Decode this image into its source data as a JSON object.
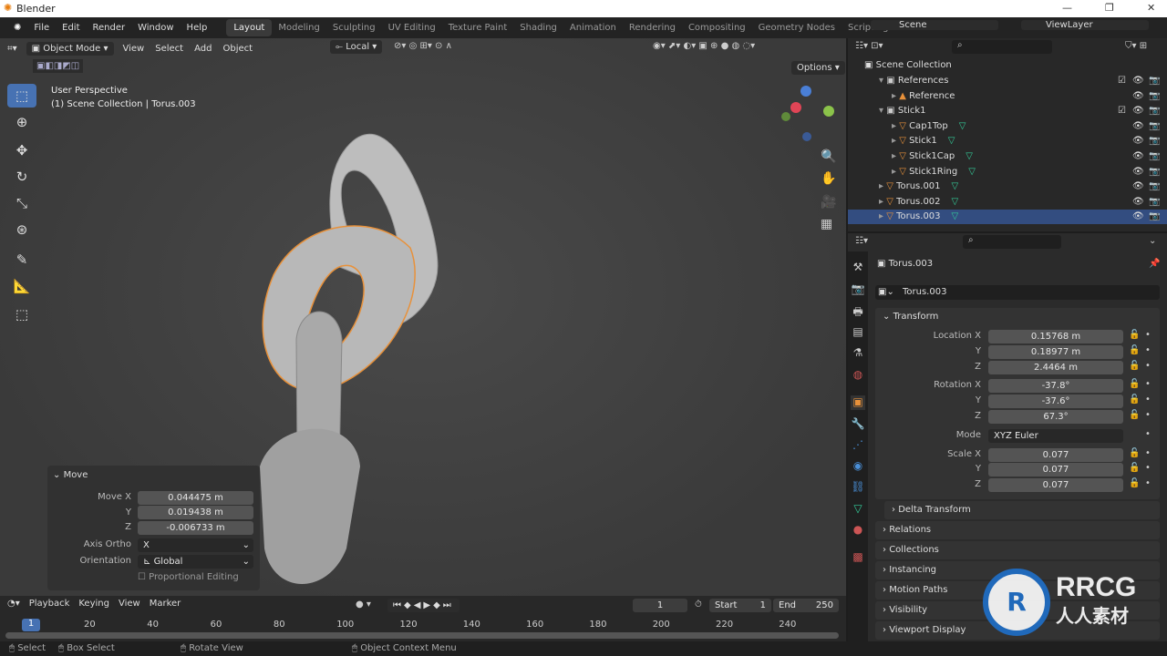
{
  "title": "Blender",
  "menu": [
    "File",
    "Edit",
    "Render",
    "Window",
    "Help"
  ],
  "workspaces": [
    "Layout",
    "Modeling",
    "Sculpting",
    "UV Editing",
    "Texture Paint",
    "Shading",
    "Animation",
    "Rendering",
    "Compositing",
    "Geometry Nodes",
    "Scripting"
  ],
  "active_workspace": "Layout",
  "scene": "Scene",
  "view_layer": "ViewLayer",
  "viewport": {
    "mode": "Object Mode",
    "menus": [
      "View",
      "Select",
      "Add",
      "Object"
    ],
    "pivot": "Local",
    "options": "Options",
    "info_line1": "User Perspective",
    "info_line2": "(1) Scene Collection | Torus.003"
  },
  "move_panel": {
    "title": "Move",
    "move_x_label": "Move X",
    "move_x": "0.044475 m",
    "y_label": "Y",
    "move_y": "0.019438 m",
    "z_label": "Z",
    "move_z": "-0.006733 m",
    "axis_ortho_label": "Axis Ortho",
    "axis_ortho": "X",
    "orientation_label": "Orientation",
    "orientation": "Global",
    "proportional": "Proportional Editing"
  },
  "outliner": {
    "root": "Scene Collection",
    "items": [
      {
        "name": "References",
        "depth": 1,
        "type": "collection"
      },
      {
        "name": "Reference",
        "depth": 2,
        "type": "image"
      },
      {
        "name": "Stick1",
        "depth": 1,
        "type": "collection"
      },
      {
        "name": "Cap1Top",
        "depth": 2,
        "type": "mesh"
      },
      {
        "name": "Stick1",
        "depth": 2,
        "type": "mesh"
      },
      {
        "name": "Stick1Cap",
        "depth": 2,
        "type": "mesh"
      },
      {
        "name": "Stick1Ring",
        "depth": 2,
        "type": "mesh"
      },
      {
        "name": "Torus.001",
        "depth": 1,
        "type": "mesh"
      },
      {
        "name": "Torus.002",
        "depth": 1,
        "type": "mesh"
      },
      {
        "name": "Torus.003",
        "depth": 1,
        "type": "mesh",
        "selected": true
      }
    ]
  },
  "properties": {
    "object": "Torus.003",
    "object_field": "Torus.003",
    "transform": "Transform",
    "location_x_label": "Location X",
    "location_x": "0.15768 m",
    "location_y": "0.18977 m",
    "location_z": "2.4464 m",
    "rotation_x_label": "Rotation X",
    "rotation_x": "-37.8°",
    "rotation_y": "-37.6°",
    "rotation_z": "67.3°",
    "mode_label": "Mode",
    "mode": "XYZ Euler",
    "scale_x_label": "Scale X",
    "scale_x": "0.077",
    "scale_y": "0.077",
    "scale_z": "0.077",
    "y_label": "Y",
    "z_label": "Z",
    "sections": [
      "Delta Transform",
      "Relations",
      "Collections",
      "Instancing",
      "Motion Paths",
      "Visibility",
      "Viewport Display"
    ]
  },
  "timeline": {
    "menus": [
      "Playback",
      "Keying",
      "View",
      "Marker"
    ],
    "current_frame": "1",
    "start_label": "Start",
    "start": "1",
    "end_label": "End",
    "end": "250",
    "ticks": [
      "20",
      "40",
      "60",
      "80",
      "100",
      "120",
      "140",
      "160",
      "180",
      "200",
      "220",
      "240"
    ]
  },
  "status": {
    "select": "Select",
    "box_select": "Box Select",
    "rotate": "Rotate View",
    "context": "Object Context Menu"
  },
  "watermark": "RRCG 人人素材",
  "colors": {
    "accent": "#4772b3",
    "selection": "#e8913a",
    "selected_row": "#334d80"
  }
}
